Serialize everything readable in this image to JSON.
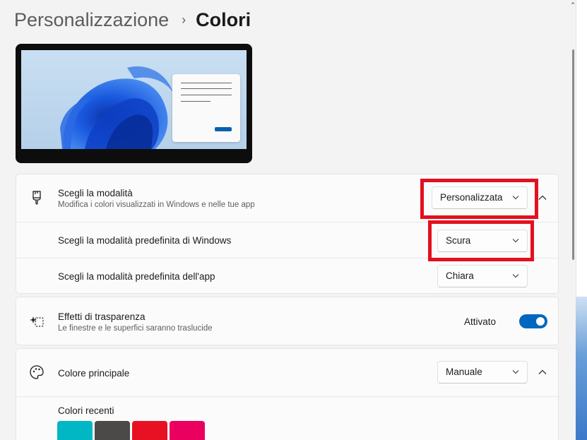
{
  "breadcrumb": {
    "parent": "Personalizzazione",
    "separator": "›",
    "current": "Colori"
  },
  "mode_card": {
    "title": "Scegli la modalità",
    "subtitle": "Modifica i colori visualizzati in Windows e nelle tue app",
    "dropdown_value": "Personalizzata",
    "windows_mode": {
      "label": "Scegli la modalità predefinita di Windows",
      "value": "Scura"
    },
    "app_mode": {
      "label": "Scegli la modalità predefinita dell'app",
      "value": "Chiara"
    }
  },
  "transparency_card": {
    "title": "Effetti di trasparenza",
    "subtitle": "Le finestre e le superfici saranno traslucide",
    "toggle_label": "Attivato",
    "toggle_on": true
  },
  "accent_card": {
    "title": "Colore principale",
    "dropdown_value": "Manuale",
    "recent_label": "Colori recenti",
    "recent_colors": [
      "#00b7c3",
      "#4c4a48",
      "#e81123",
      "#ea005e"
    ]
  },
  "colors": {
    "accent": "#0067c0",
    "highlight": "#e3101f"
  },
  "icons": [
    "chevron-right-icon",
    "paintbrush-icon",
    "chevron-down-icon",
    "chevron-up-icon",
    "sparkle-icon",
    "palette-icon"
  ]
}
